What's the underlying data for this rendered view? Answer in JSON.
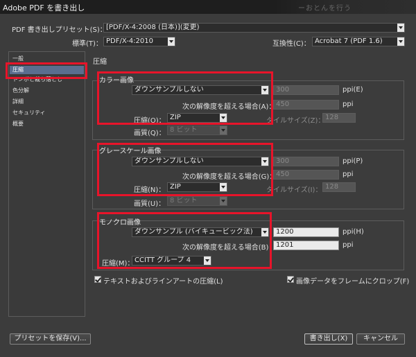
{
  "window": {
    "title": "Adobe PDF を書き出し",
    "bg_title_fragment": "ーおとんを行う",
    "preset_label": "PDF 書き出しプリセット(S)：",
    "preset_value": "[PDF/X-4:2008 (日本)](変更)",
    "standard_label": "標準(T)：",
    "standard_value": "PDF/X-4:2010",
    "compat_label": "互換性(C)：",
    "compat_value": "Acrobat 7 (PDF 1.6)"
  },
  "sidebar": {
    "items": [
      {
        "label": "一般"
      },
      {
        "label": "圧縮"
      },
      {
        "label": "トンボと裁ち落とし"
      },
      {
        "label": "色分解"
      },
      {
        "label": "詳細"
      },
      {
        "label": "セキュリティ"
      },
      {
        "label": "概要"
      }
    ]
  },
  "panel": {
    "title": "圧縮"
  },
  "color": {
    "title": "カラー画像",
    "downsample_value": "ダウンサンプルしない",
    "res_value": "300",
    "res_unit": "ppi(E)",
    "above_label": "次の解像度を超える場合(A)：",
    "above_value": "450",
    "above_unit": "ppi",
    "comp_label": "圧縮(O)：",
    "comp_value": "ZIP",
    "tile_label": "タイルサイズ(Z)：",
    "tile_value": "128",
    "quality_label": "画質(Q)：",
    "quality_value": "8 ビット"
  },
  "gray": {
    "title": "グレースケール画像",
    "downsample_value": "ダウンサンプルしない",
    "res_value": "300",
    "res_unit": "ppi(P)",
    "above_label": "次の解像度を超える場合(G)：",
    "above_value": "450",
    "above_unit": "ppi",
    "comp_label": "圧縮(N)：",
    "comp_value": "ZIP",
    "tile_label": "タイルサイズ(I)：",
    "tile_value": "128",
    "quality_label": "画質(U)：",
    "quality_value": "8 ビット"
  },
  "mono": {
    "title": "モノクロ画像",
    "downsample_value": "ダウンサンプル (バイキュービック法)",
    "res_value": "1200",
    "res_unit": "ppi(H)",
    "above_label": "次の解像度を超える場合(B)：",
    "above_value": "1201",
    "above_unit": "ppi",
    "comp_label": "圧縮(M)：",
    "comp_value": "CCITT グループ 4"
  },
  "options": {
    "text_art": "テキストおよびラインアートの圧縮(L)",
    "crop": "画像データをフレームにクロップ(F)"
  },
  "buttons": {
    "save_preset": "プリセットを保存(V)...",
    "export": "書き出し(X)",
    "cancel": "キャンセル"
  },
  "colors": {
    "highlight": "#e8142a",
    "selected_bg": "#5a6e8f"
  }
}
